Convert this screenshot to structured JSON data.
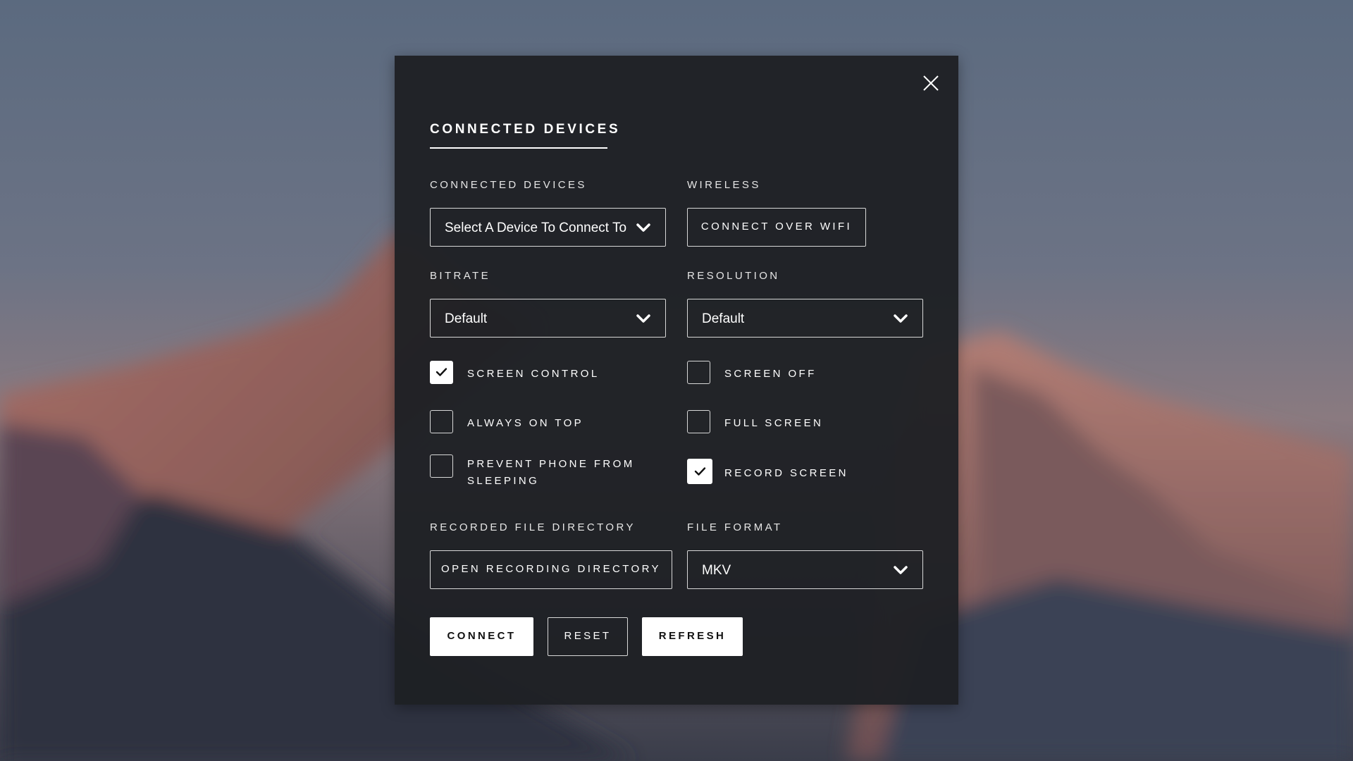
{
  "dialog": {
    "title": "CONNECTED DEVICES",
    "close_icon": "close-icon"
  },
  "connected_devices": {
    "label": "CONNECTED DEVICES",
    "selected": "Select A Device To Connect To"
  },
  "wireless": {
    "label": "WIRELESS",
    "button_label": "CONNECT OVER WIFI"
  },
  "bitrate": {
    "label": "BITRATE",
    "selected": "Default"
  },
  "resolution": {
    "label": "RESOLUTION",
    "selected": "Default"
  },
  "options": {
    "screen_control": {
      "label": "SCREEN CONTROL",
      "checked": true
    },
    "screen_off": {
      "label": "SCREEN OFF",
      "checked": false
    },
    "always_on_top": {
      "label": "ALWAYS ON TOP",
      "checked": false
    },
    "full_screen": {
      "label": "FULL SCREEN",
      "checked": false
    },
    "prevent_sleep": {
      "label_line1": "PREVENT PHONE FROM",
      "label_line2": "SLEEPING",
      "checked": false
    },
    "record_screen": {
      "label": "RECORD SCREEN",
      "checked": true
    }
  },
  "recorded_file_directory": {
    "label": "RECORDED FILE DIRECTORY",
    "button_label": "OPEN RECORDING DIRECTORY"
  },
  "file_format": {
    "label": "FILE FORMAT",
    "selected": "MKV"
  },
  "actions": {
    "connect_label": "CONNECT",
    "reset_label": "RESET",
    "refresh_label": "REFRESH"
  },
  "icons": {
    "dropdown": "chevron-down-icon",
    "check": "checkmark-icon"
  },
  "colors": {
    "dialog_bg": "#1e2024",
    "border": "#d8d8d8",
    "text": "#ffffff",
    "solid_button_bg": "#ffffff",
    "solid_button_text": "#111111"
  }
}
